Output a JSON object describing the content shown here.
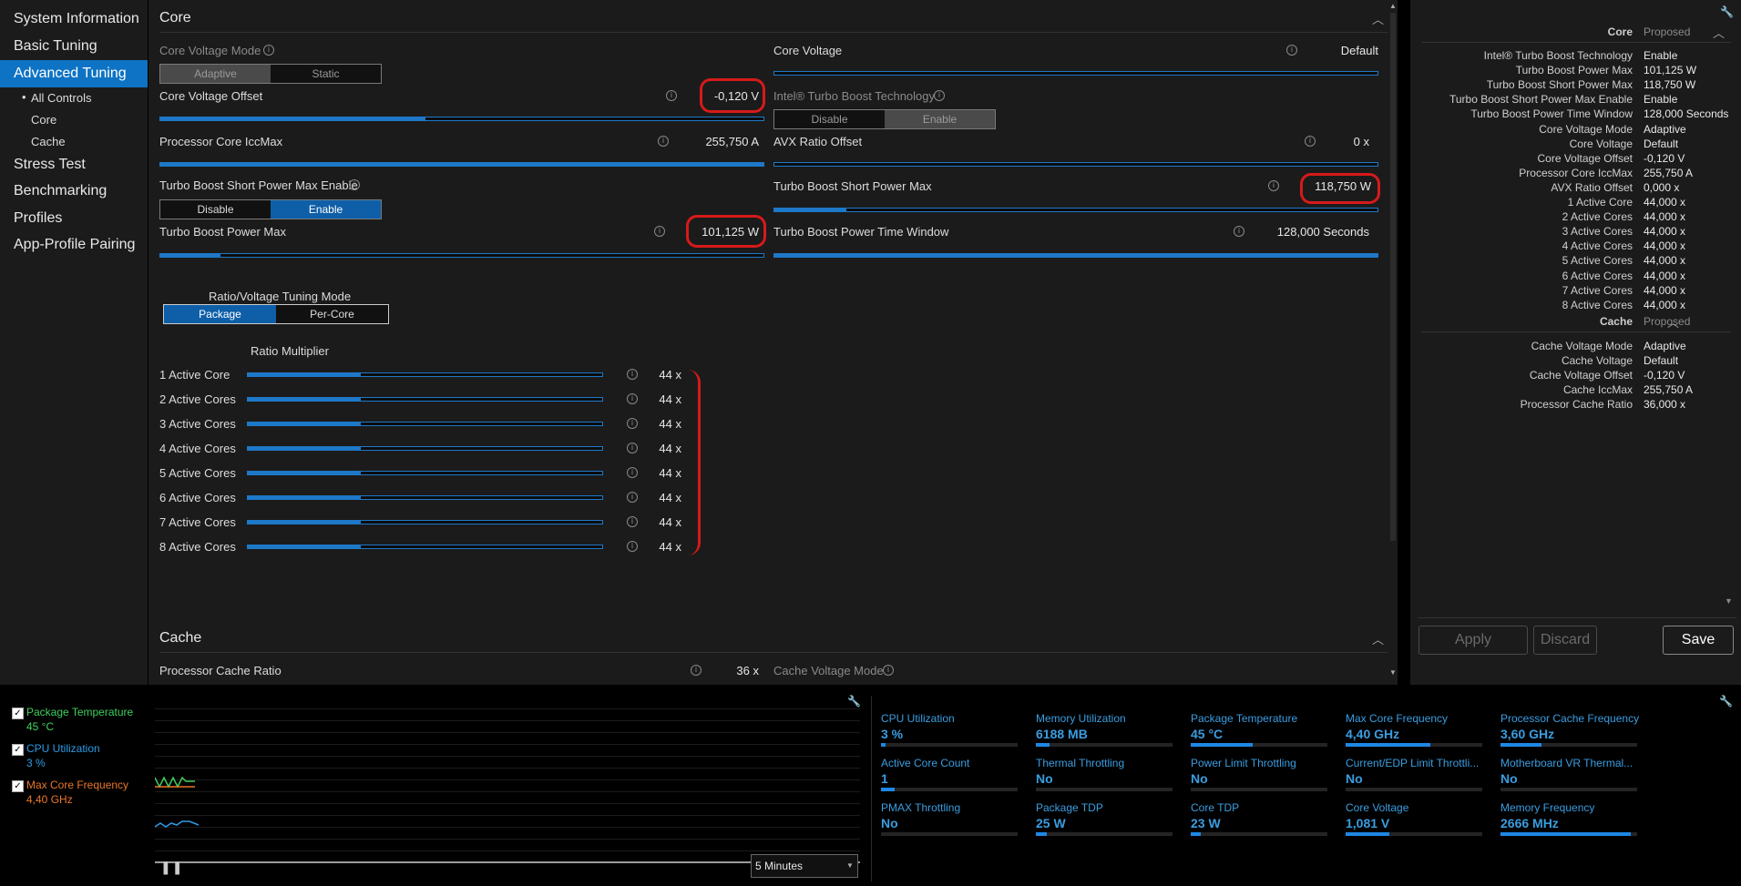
{
  "sidebar": {
    "items": [
      "System Information",
      "Basic Tuning",
      "Advanced Tuning",
      "Stress Test",
      "Benchmarking",
      "Profiles",
      "App-Profile Pairing"
    ],
    "subitems": [
      "All Controls",
      "Core",
      "Cache"
    ],
    "bullet": "•"
  },
  "core": {
    "title": "Core",
    "core_voltage_mode": {
      "label": "Core Voltage Mode",
      "options": [
        "Adaptive",
        "Static"
      ]
    },
    "core_voltage": {
      "label": "Core Voltage",
      "value": "Default"
    },
    "core_voltage_offset": {
      "label": "Core Voltage Offset",
      "value": "-0,120 V",
      "fill": 0.44
    },
    "turbo_boost_tech": {
      "label": "Intel® Turbo Boost Technology",
      "options": [
        "Disable",
        "Enable"
      ]
    },
    "iccmax": {
      "label": "Processor Core IccMax",
      "value": "255,750 A",
      "fill": 1.0
    },
    "avx": {
      "label": "AVX Ratio Offset",
      "value": "0 x",
      "fill": 0.0
    },
    "short_enable": {
      "label": "Turbo Boost Short Power Max Enable",
      "options": [
        "Disable",
        "Enable"
      ]
    },
    "short_power": {
      "label": "Turbo Boost Short Power Max",
      "value": "118,750 W",
      "fill": 0.12
    },
    "power_max": {
      "label": "Turbo Boost Power Max",
      "value": "101,125 W",
      "fill": 0.1
    },
    "time_window": {
      "label": "Turbo Boost Power Time Window",
      "value": "128,000 Seconds",
      "fill": 1.0
    },
    "tuning_mode": {
      "label": "Ratio/Voltage Tuning Mode",
      "options": [
        "Package",
        "Per-Core"
      ]
    },
    "ratio_header": "Ratio Multiplier",
    "ratios": [
      {
        "label": "1 Active Core",
        "value": "44 x",
        "fill": 0.32
      },
      {
        "label": "2 Active Cores",
        "value": "44 x",
        "fill": 0.32
      },
      {
        "label": "3 Active Cores",
        "value": "44 x",
        "fill": 0.32
      },
      {
        "label": "4 Active Cores",
        "value": "44 x",
        "fill": 0.32
      },
      {
        "label": "5 Active Cores",
        "value": "44 x",
        "fill": 0.32
      },
      {
        "label": "6 Active Cores",
        "value": "44 x",
        "fill": 0.32
      },
      {
        "label": "7 Active Cores",
        "value": "44 x",
        "fill": 0.32
      },
      {
        "label": "8 Active Cores",
        "value": "44 x",
        "fill": 0.32
      }
    ]
  },
  "cache": {
    "title": "Cache",
    "ratio": {
      "label": "Processor Cache Ratio",
      "value": "36 x"
    },
    "voltage_mode": {
      "label": "Cache Voltage Mode"
    }
  },
  "proposed": {
    "core_header": "Core",
    "cache_header": "Cache",
    "col_label": "Proposed",
    "core_rows": [
      [
        "Intel® Turbo Boost Technology",
        "Enable"
      ],
      [
        "Turbo Boost Power Max",
        "101,125 W"
      ],
      [
        "Turbo Boost Short Power Max",
        "118,750 W"
      ],
      [
        "Turbo Boost Short Power Max Enable",
        "Enable"
      ],
      [
        "Turbo Boost Power Time Window",
        "128,000 Seconds"
      ],
      [
        "Core Voltage Mode",
        "Adaptive"
      ],
      [
        "Core Voltage",
        "Default"
      ],
      [
        "Core Voltage Offset",
        "-0,120 V"
      ],
      [
        "Processor Core IccMax",
        "255,750 A"
      ],
      [
        "AVX Ratio Offset",
        "0,000 x"
      ],
      [
        "1 Active Core",
        "44,000 x"
      ],
      [
        "2 Active Cores",
        "44,000 x"
      ],
      [
        "3 Active Cores",
        "44,000 x"
      ],
      [
        "4 Active Cores",
        "44,000 x"
      ],
      [
        "5 Active Cores",
        "44,000 x"
      ],
      [
        "6 Active Cores",
        "44,000 x"
      ],
      [
        "7 Active Cores",
        "44,000 x"
      ],
      [
        "8 Active Cores",
        "44,000 x"
      ]
    ],
    "cache_rows": [
      [
        "Cache Voltage Mode",
        "Adaptive"
      ],
      [
        "Cache Voltage",
        "Default"
      ],
      [
        "Cache Voltage Offset",
        "-0,120 V"
      ],
      [
        "Cache IccMax",
        "255,750 A"
      ],
      [
        "Processor Cache Ratio",
        "36,000 x"
      ]
    ],
    "buttons": {
      "apply": "Apply",
      "discard": "Discard",
      "save": "Save"
    }
  },
  "monitor": {
    "legend": [
      {
        "name": "Package Temperature",
        "value": "45 °C",
        "color": "#3ecf5e"
      },
      {
        "name": "CPU Utilization",
        "value": "3 %",
        "color": "#2e9be6"
      },
      {
        "name": "Max Core Frequency",
        "value": "4,40 GHz",
        "color": "#e8762a"
      }
    ],
    "duration": "5 Minutes",
    "metrics": [
      {
        "label": "CPU Utilization",
        "value": "3 %",
        "fill": 0.03
      },
      {
        "label": "Memory Utilization",
        "value": "6188  MB",
        "fill": 0.1
      },
      {
        "label": "Package Temperature",
        "value": "45 °C",
        "fill": 0.45
      },
      {
        "label": "Max Core Frequency",
        "value": "4,40 GHz",
        "fill": 0.62
      },
      {
        "label": "Processor Cache Frequency",
        "value": "3,60 GHz",
        "fill": 0.3
      },
      {
        "label": "Active Core Count",
        "value": "1",
        "fill": 0.1
      },
      {
        "label": "Thermal Throttling",
        "value": "No",
        "fill": 0
      },
      {
        "label": "Power Limit Throttling",
        "value": "No",
        "fill": 0
      },
      {
        "label": "Current/EDP Limit Throttli...",
        "value": "No",
        "fill": 0
      },
      {
        "label": "Motherboard VR Thermal...",
        "value": "No",
        "fill": 0
      },
      {
        "label": "PMAX Throttling",
        "value": "No",
        "fill": 0
      },
      {
        "label": "Package TDP",
        "value": "25 W",
        "fill": 0.08
      },
      {
        "label": "Core TDP",
        "value": "23 W",
        "fill": 0.07
      },
      {
        "label": "Core Voltage",
        "value": "1,081 V",
        "fill": 0.32
      },
      {
        "label": "Memory Frequency",
        "value": "2666 MHz",
        "fill": 0.95
      }
    ]
  },
  "colors": {
    "accent": "#0e73c4",
    "slider": "#1e78c8",
    "highlight": "#d61a1a"
  },
  "icons": [
    "info-icon",
    "chevron-up-icon",
    "chevron-down-icon",
    "wrench-icon",
    "pause-icon",
    "checkbox-icon"
  ]
}
